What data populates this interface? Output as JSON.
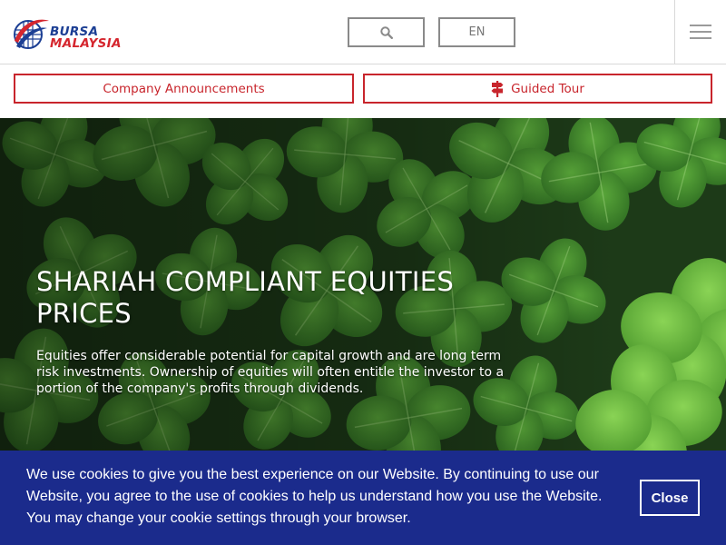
{
  "header": {
    "logo": {
      "line1": "BURSA",
      "line2": "MALAYSIA"
    },
    "search_icon": "search-icon",
    "language_label": "EN",
    "menu_icon": "hamburger-menu-icon"
  },
  "subnav": {
    "announcements_label": "Company Announcements",
    "tour_label": "Guided Tour",
    "tour_icon": "signpost-icon"
  },
  "hero": {
    "title": "SHARIAH COMPLIANT EQUITIES PRICES",
    "description": "Equities offer considerable potential for capital growth and are long term risk investments. Ownership of equities will often entitle the investor to a portion of the company's profits through dividends."
  },
  "cookie_banner": {
    "message": "We use cookies to give you the best experience on our Website. By continuing to use our Website, you agree to the use of cookies to help us understand how you use the Website. You may change your cookie settings through your browser.",
    "close_label": "Close"
  },
  "colors": {
    "brand_red": "#c8252c",
    "brand_blue": "#1c3f94",
    "cookie_bg": "#1b2b8c",
    "border_gray": "#8a8a8a"
  }
}
